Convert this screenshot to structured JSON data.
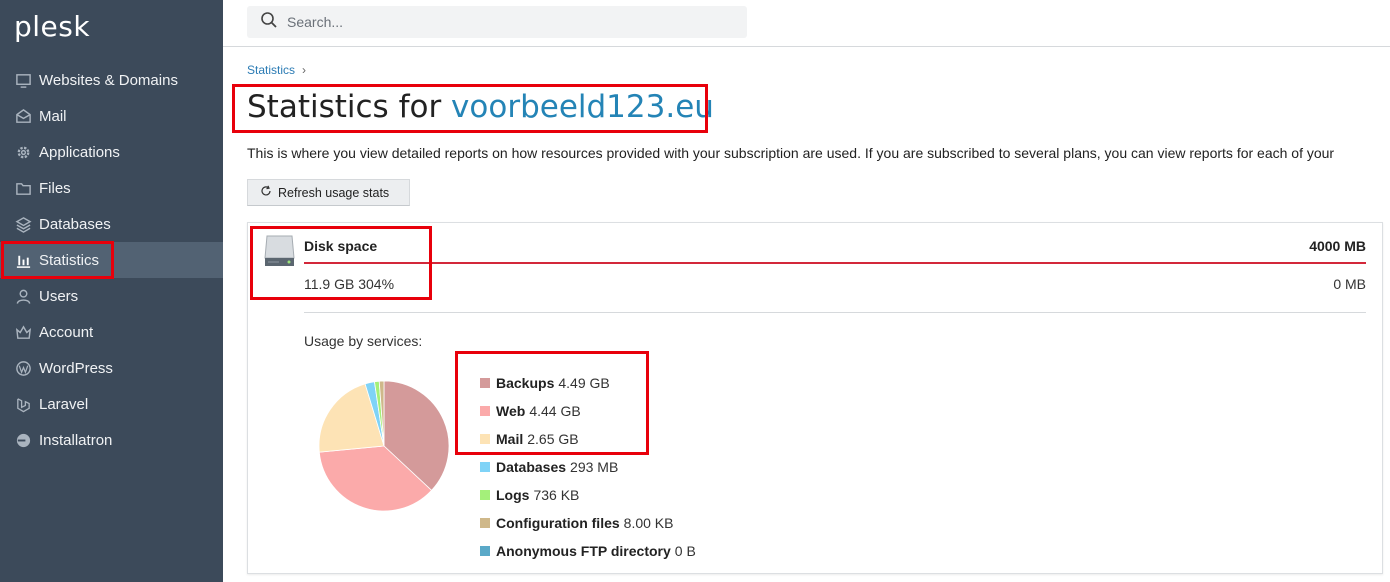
{
  "app": {
    "logo": "plesk"
  },
  "sidebar": {
    "items": [
      {
        "label": "Websites & Domains",
        "icon": "monitor-icon"
      },
      {
        "label": "Mail",
        "icon": "envelope-icon"
      },
      {
        "label": "Applications",
        "icon": "gear-icon"
      },
      {
        "label": "Files",
        "icon": "folder-icon"
      },
      {
        "label": "Databases",
        "icon": "layers-icon"
      },
      {
        "label": "Statistics",
        "icon": "bar-chart-icon",
        "active": true
      },
      {
        "label": "Users",
        "icon": "user-icon"
      },
      {
        "label": "Account",
        "icon": "crown-icon"
      },
      {
        "label": "WordPress",
        "icon": "wordpress-icon"
      },
      {
        "label": "Laravel",
        "icon": "laravel-icon"
      },
      {
        "label": "Installatron",
        "icon": "installatron-icon"
      }
    ]
  },
  "search": {
    "placeholder": "Search..."
  },
  "breadcrumb": {
    "item": "Statistics",
    "separator": "›"
  },
  "page": {
    "title_prefix": "Statistics for ",
    "domain": "voorbeeld123.eu",
    "description": "This is where you view detailed reports on how resources provided with your subscription are used. If you are subscribed to several plans, you can view reports for each of your",
    "refresh_label": "Refresh usage stats"
  },
  "disk": {
    "title": "Disk space",
    "limit": "4000 MB",
    "used": "11.9 GB 304%",
    "remaining": "0 MB",
    "usage_label": "Usage by services:"
  },
  "chart_data": {
    "type": "pie",
    "title": "",
    "slices": [
      {
        "name": "Backups",
        "value_label": "4.49 GB",
        "value_mb": 4597.76,
        "color": "#d49a9a"
      },
      {
        "name": "Web",
        "value_label": "4.44 GB",
        "value_mb": 4546.56,
        "color": "#fbaaaa"
      },
      {
        "name": "Mail",
        "value_label": "2.65 GB",
        "value_mb": 2713.6,
        "color": "#fde3b5"
      },
      {
        "name": "Databases",
        "value_label": "293 MB",
        "value_mb": 293,
        "color": "#7fd3f7"
      },
      {
        "name": "Logs",
        "value_label": "736 KB",
        "value_mb": 0.72,
        "color": "#a4f07a"
      },
      {
        "name": "Configuration files",
        "value_label": "8.00 KB",
        "value_mb": 0.0078,
        "color": "#cfb88a"
      },
      {
        "name": "Anonymous FTP directory",
        "value_label": "0 B",
        "value_mb": 0,
        "color": "#5aa9c8"
      }
    ],
    "legend_position": "right"
  },
  "colors": {
    "sidebar_bg": "#3c4a5a",
    "sidebar_active": "#526273",
    "link": "#2484b6",
    "usage_bar": "#d3283a",
    "annotation_box": "#e8000b"
  }
}
